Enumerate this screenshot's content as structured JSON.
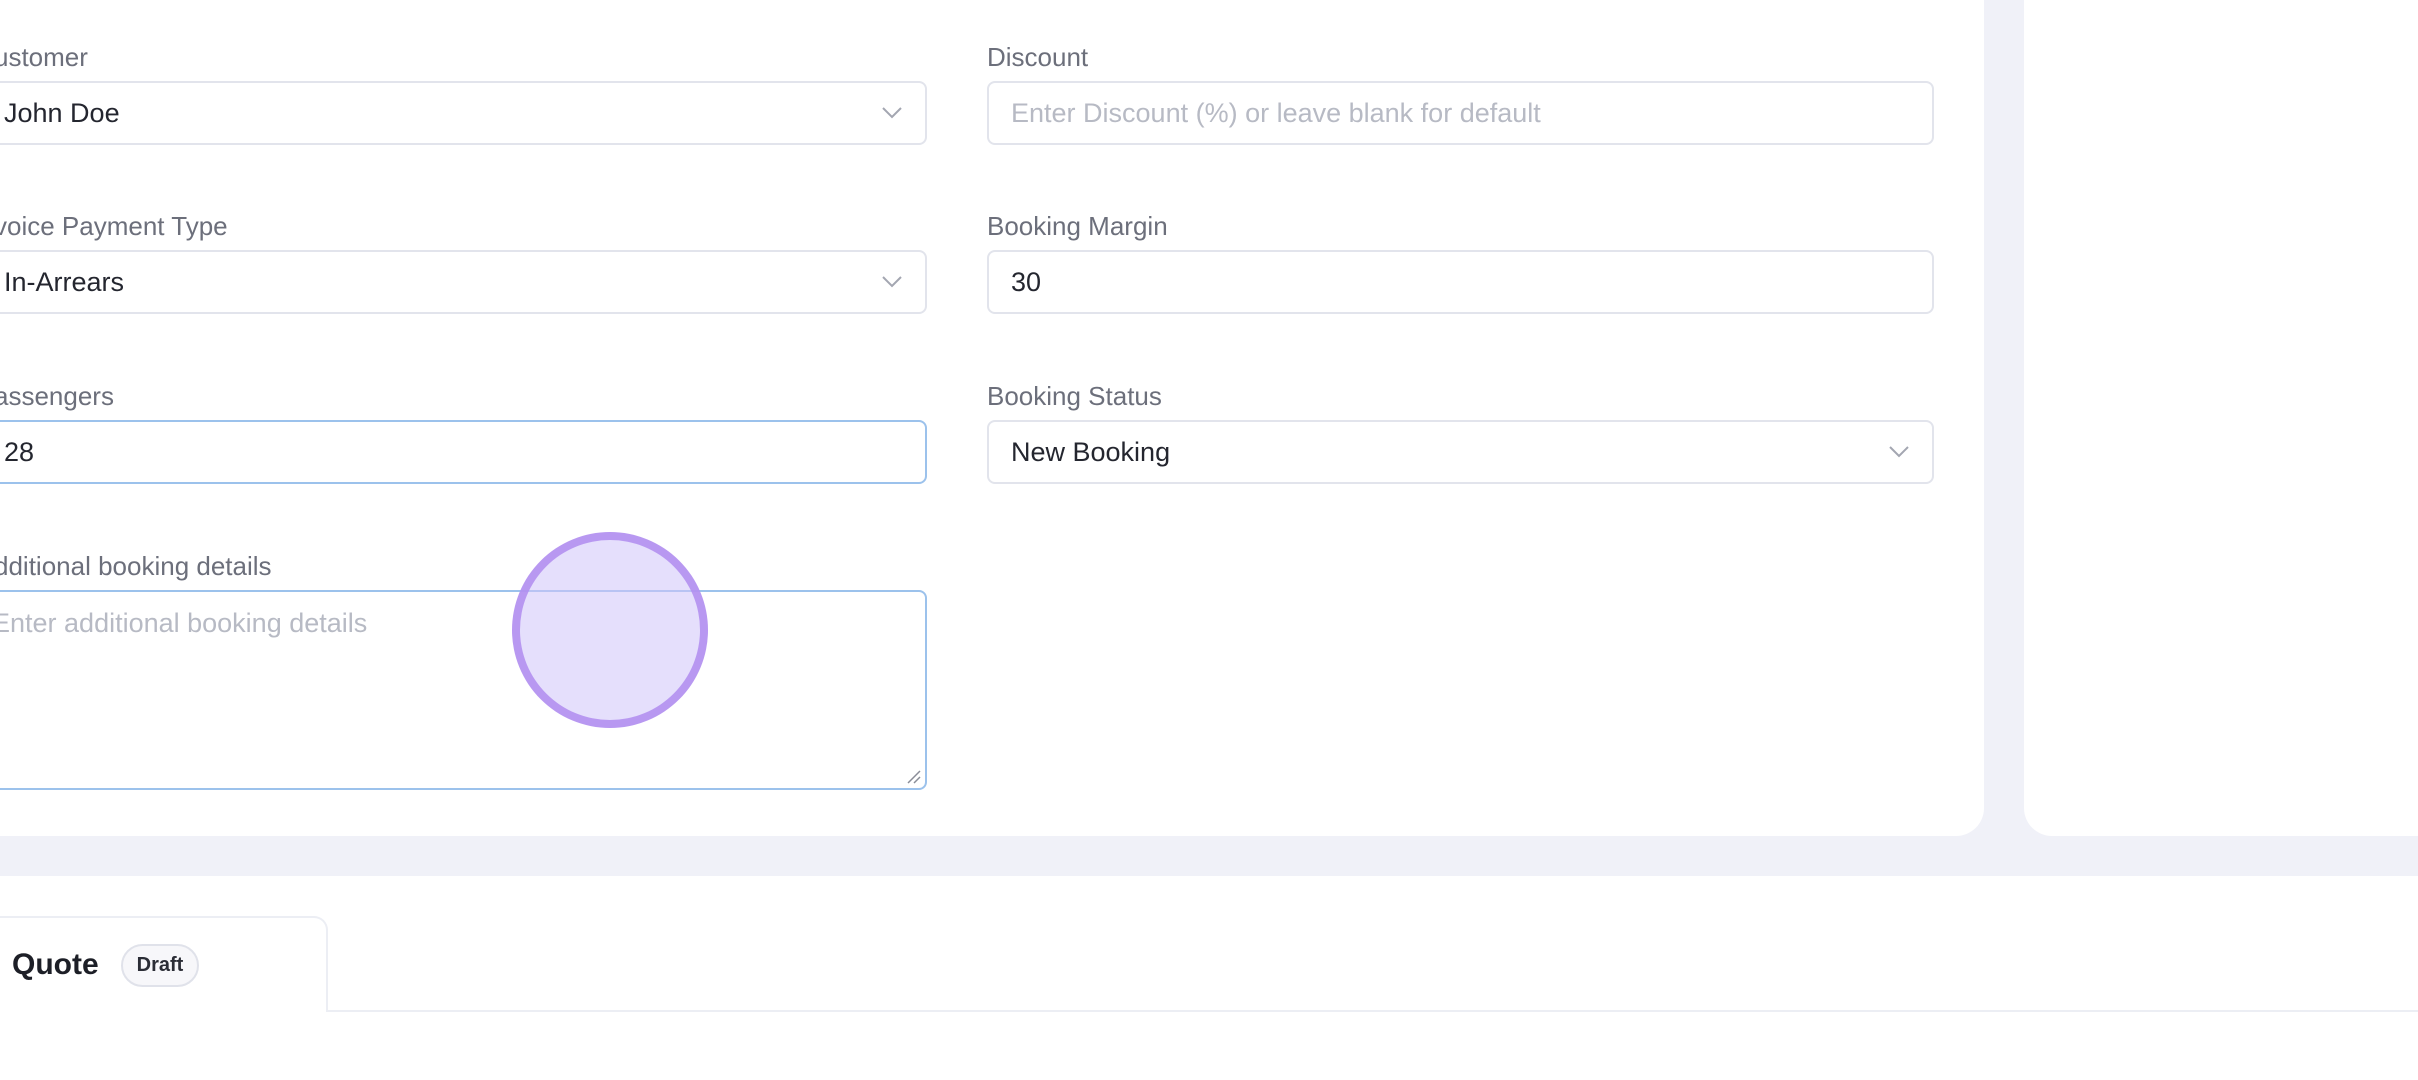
{
  "form": {
    "customer": {
      "label": "ustomer",
      "value": "John Doe"
    },
    "discount": {
      "label": "Discount",
      "placeholder": "Enter Discount (%) or leave blank for default"
    },
    "invoice_payment_type": {
      "label": "voice Payment Type",
      "value": "In-Arrears"
    },
    "booking_margin": {
      "label": "Booking Margin",
      "value": "30"
    },
    "passengers": {
      "label": "assengers",
      "value": "28"
    },
    "booking_status": {
      "label": "Booking Status",
      "value": "New Booking"
    },
    "additional_details": {
      "label": "dditional booking details",
      "placeholder": "Enter additional booking details"
    }
  },
  "tabs": [
    {
      "label": "Quote",
      "badge": "Draft"
    }
  ],
  "colors": {
    "focus_border": "#9cc2ec",
    "click_marker": "#b08cf0",
    "page_background": "#f0f1f8"
  }
}
